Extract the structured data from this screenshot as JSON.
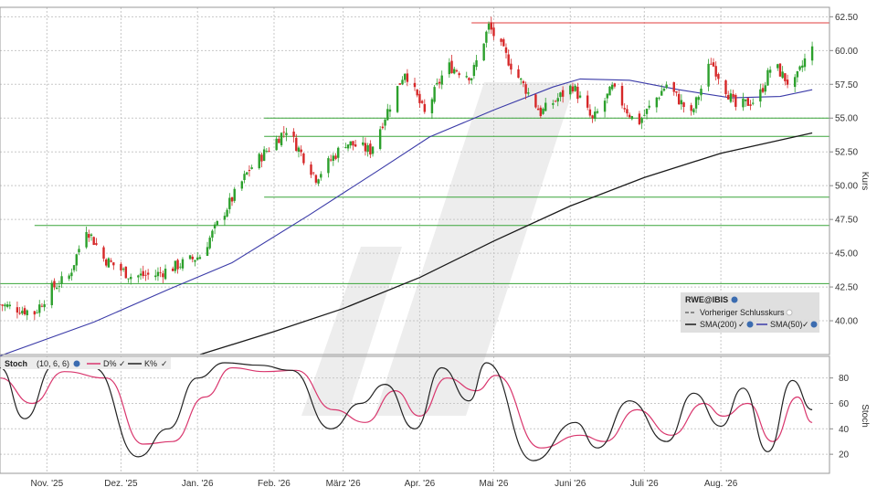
{
  "chart_data": [
    {
      "type": "candlestick",
      "symbol_label": "RWE@IBIS",
      "ylabel": "Kurs",
      "ylim": [
        37.5,
        63.2
      ],
      "y_ticks": [
        "40.00",
        "42.50",
        "45.00",
        "47.50",
        "50.00",
        "52.50",
        "55.00",
        "57.50",
        "60.00",
        "62.50"
      ],
      "x_ticks": [
        "Nov. '25",
        "Dez. '25",
        "Jan. '26",
        "Feb. '26",
        "März '26",
        "Apr. '26",
        "Mai '26",
        "Juni '26",
        "Juli '26",
        "Aug. '26"
      ],
      "x_start": "2025-10-13",
      "x_end": "2026-09-14",
      "tick_dates": [
        "2025-11-01",
        "2025-12-01",
        "2026-01-01",
        "2026-02-01",
        "2026-03-01",
        "2026-04-01",
        "2026-05-01",
        "2026-06-01",
        "2026-07-01",
        "2026-08-01"
      ],
      "grid": true,
      "key_points": [
        {
          "date": "2025-10-13",
          "close": 41.2
        },
        {
          "date": "2025-10-27",
          "close": 40.6
        },
        {
          "date": "2025-11-03",
          "close": 42.4
        },
        {
          "date": "2025-11-10",
          "close": 43.3
        },
        {
          "date": "2025-11-17",
          "close": 46.9
        },
        {
          "date": "2025-11-24",
          "close": 44.6
        },
        {
          "date": "2025-12-05",
          "close": 43.3
        },
        {
          "date": "2025-12-15",
          "close": 43.4
        },
        {
          "date": "2026-01-02",
          "close": 44.8
        },
        {
          "date": "2026-01-12",
          "close": 48.1
        },
        {
          "date": "2026-01-22",
          "close": 51.2
        },
        {
          "date": "2026-02-06",
          "close": 54.2
        },
        {
          "date": "2026-02-18",
          "close": 50.6
        },
        {
          "date": "2026-03-02",
          "close": 53.2
        },
        {
          "date": "2026-03-12",
          "close": 52.6
        },
        {
          "date": "2026-03-26",
          "close": 58.5
        },
        {
          "date": "2026-04-03",
          "close": 55.3
        },
        {
          "date": "2026-04-12",
          "close": 58.9
        },
        {
          "date": "2026-04-22",
          "close": 58.1
        },
        {
          "date": "2026-04-29",
          "close": 61.8
        },
        {
          "date": "2026-05-10",
          "close": 58.3
        },
        {
          "date": "2026-05-20",
          "close": 55.4
        },
        {
          "date": "2026-06-02",
          "close": 57.4
        },
        {
          "date": "2026-06-10",
          "close": 54.8
        },
        {
          "date": "2026-06-18",
          "close": 57.2
        },
        {
          "date": "2026-06-28",
          "close": 54.5
        },
        {
          "date": "2026-07-10",
          "close": 57.5
        },
        {
          "date": "2026-07-20",
          "close": 55.2
        },
        {
          "date": "2026-07-28",
          "close": 59.2
        },
        {
          "date": "2026-08-07",
          "close": 55.8
        },
        {
          "date": "2026-08-16",
          "close": 56.4
        },
        {
          "date": "2026-08-22",
          "close": 59.1
        },
        {
          "date": "2026-08-30",
          "close": 57.2
        },
        {
          "date": "2026-09-04",
          "close": 59.3
        },
        {
          "date": "2026-09-07",
          "close": 60.1
        }
      ],
      "sma50": [
        {
          "date": "2025-10-13",
          "value": 37.4
        },
        {
          "date": "2025-11-20",
          "value": 39.9
        },
        {
          "date": "2025-12-20",
          "value": 42.3
        },
        {
          "date": "2026-01-15",
          "value": 44.3
        },
        {
          "date": "2026-02-15",
          "value": 47.8
        },
        {
          "date": "2026-03-15",
          "value": 51.1
        },
        {
          "date": "2026-04-05",
          "value": 53.6
        },
        {
          "date": "2026-05-01",
          "value": 55.6
        },
        {
          "date": "2026-05-25",
          "value": 57.3
        },
        {
          "date": "2026-06-05",
          "value": 57.9
        },
        {
          "date": "2026-06-25",
          "value": 57.8
        },
        {
          "date": "2026-07-15",
          "value": 57.1
        },
        {
          "date": "2026-08-05",
          "value": 56.5
        },
        {
          "date": "2026-08-25",
          "value": 56.6
        },
        {
          "date": "2026-09-07",
          "value": 57.1
        }
      ],
      "sma200": [
        {
          "date": "2026-01-02",
          "value": 37.5
        },
        {
          "date": "2026-02-01",
          "value": 39.2
        },
        {
          "date": "2026-03-01",
          "value": 40.9
        },
        {
          "date": "2026-04-01",
          "value": 43.2
        },
        {
          "date": "2026-05-01",
          "value": 45.9
        },
        {
          "date": "2026-06-01",
          "value": 48.5
        },
        {
          "date": "2026-07-01",
          "value": 50.6
        },
        {
          "date": "2026-08-01",
          "value": 52.4
        },
        {
          "date": "2026-09-07",
          "value": 53.9
        }
      ],
      "resistance_line": {
        "value": 62.05,
        "from": "2026-04-22",
        "color": "#e03c3c"
      },
      "support_lines": [
        {
          "value": 55.0,
          "from": "2026-01-28"
        },
        {
          "value": 53.65,
          "from": "2026-01-28"
        },
        {
          "value": 49.15,
          "from": "2026-01-28"
        },
        {
          "value": 47.05,
          "from": "2025-10-27"
        },
        {
          "value": 42.75,
          "from": "2025-10-13"
        }
      ],
      "legend": {
        "title": "RWE@IBIS",
        "prev_close_label": "Vorheriger Schlusskurs",
        "sma200_label": "SMA(200)",
        "sma50_label": "SMA(50)"
      },
      "colors": {
        "up": "#2ca02c",
        "down": "#d62728",
        "sma50": "#3b3ba8",
        "sma200": "#1a1a1a",
        "support": "#3aa53a",
        "grid": "#c8c8c8",
        "legend_bg": "#d9d9d9"
      }
    },
    {
      "type": "line",
      "title": "Stoch",
      "params": "(10, 6, 6)",
      "ylabel": "Stoch",
      "ylim": [
        5,
        97
      ],
      "y_ticks": [
        "20",
        "40",
        "60",
        "80"
      ],
      "grid": true,
      "series": [
        {
          "name": "D%",
          "color": "#d9376e",
          "points": [
            {
              "date": "2025-10-13",
              "value": 80
            },
            {
              "date": "2025-10-26",
              "value": 60
            },
            {
              "date": "2025-11-08",
              "value": 85
            },
            {
              "date": "2025-11-25",
              "value": 80
            },
            {
              "date": "2025-12-10",
              "value": 28
            },
            {
              "date": "2025-12-22",
              "value": 30
            },
            {
              "date": "2026-01-04",
              "value": 65
            },
            {
              "date": "2026-01-15",
              "value": 88
            },
            {
              "date": "2026-01-28",
              "value": 85
            },
            {
              "date": "2026-02-10",
              "value": 86
            },
            {
              "date": "2026-02-25",
              "value": 55
            },
            {
              "date": "2026-03-10",
              "value": 45
            },
            {
              "date": "2026-03-22",
              "value": 70
            },
            {
              "date": "2026-04-01",
              "value": 50
            },
            {
              "date": "2026-04-12",
              "value": 80
            },
            {
              "date": "2026-04-24",
              "value": 70
            },
            {
              "date": "2026-05-02",
              "value": 82
            },
            {
              "date": "2026-05-20",
              "value": 25
            },
            {
              "date": "2026-06-05",
              "value": 35
            },
            {
              "date": "2026-06-15",
              "value": 30
            },
            {
              "date": "2026-06-28",
              "value": 55
            },
            {
              "date": "2026-07-12",
              "value": 35
            },
            {
              "date": "2026-07-25",
              "value": 60
            },
            {
              "date": "2026-08-02",
              "value": 50
            },
            {
              "date": "2026-08-12",
              "value": 60
            },
            {
              "date": "2026-08-22",
              "value": 30
            },
            {
              "date": "2026-09-01",
              "value": 65
            },
            {
              "date": "2026-09-07",
              "value": 45
            }
          ]
        },
        {
          "name": "K%",
          "color": "#222222",
          "points": [
            {
              "date": "2025-10-13",
              "value": 88
            },
            {
              "date": "2025-10-23",
              "value": 48
            },
            {
              "date": "2025-11-04",
              "value": 90
            },
            {
              "date": "2025-11-20",
              "value": 88
            },
            {
              "date": "2025-12-08",
              "value": 18
            },
            {
              "date": "2025-12-20",
              "value": 40
            },
            {
              "date": "2026-01-01",
              "value": 80
            },
            {
              "date": "2026-01-12",
              "value": 92
            },
            {
              "date": "2026-01-26",
              "value": 90
            },
            {
              "date": "2026-02-08",
              "value": 86
            },
            {
              "date": "2026-02-24",
              "value": 40
            },
            {
              "date": "2026-03-08",
              "value": 60
            },
            {
              "date": "2026-03-18",
              "value": 75
            },
            {
              "date": "2026-03-30",
              "value": 40
            },
            {
              "date": "2026-04-10",
              "value": 88
            },
            {
              "date": "2026-04-21",
              "value": 62
            },
            {
              "date": "2026-04-28",
              "value": 92
            },
            {
              "date": "2026-05-17",
              "value": 15
            },
            {
              "date": "2026-06-03",
              "value": 45
            },
            {
              "date": "2026-06-12",
              "value": 25
            },
            {
              "date": "2026-06-25",
              "value": 62
            },
            {
              "date": "2026-07-10",
              "value": 30
            },
            {
              "date": "2026-07-21",
              "value": 68
            },
            {
              "date": "2026-08-01",
              "value": 42
            },
            {
              "date": "2026-08-10",
              "value": 72
            },
            {
              "date": "2026-08-20",
              "value": 22
            },
            {
              "date": "2026-08-30",
              "value": 78
            },
            {
              "date": "2026-09-07",
              "value": 55
            }
          ]
        }
      ]
    }
  ]
}
